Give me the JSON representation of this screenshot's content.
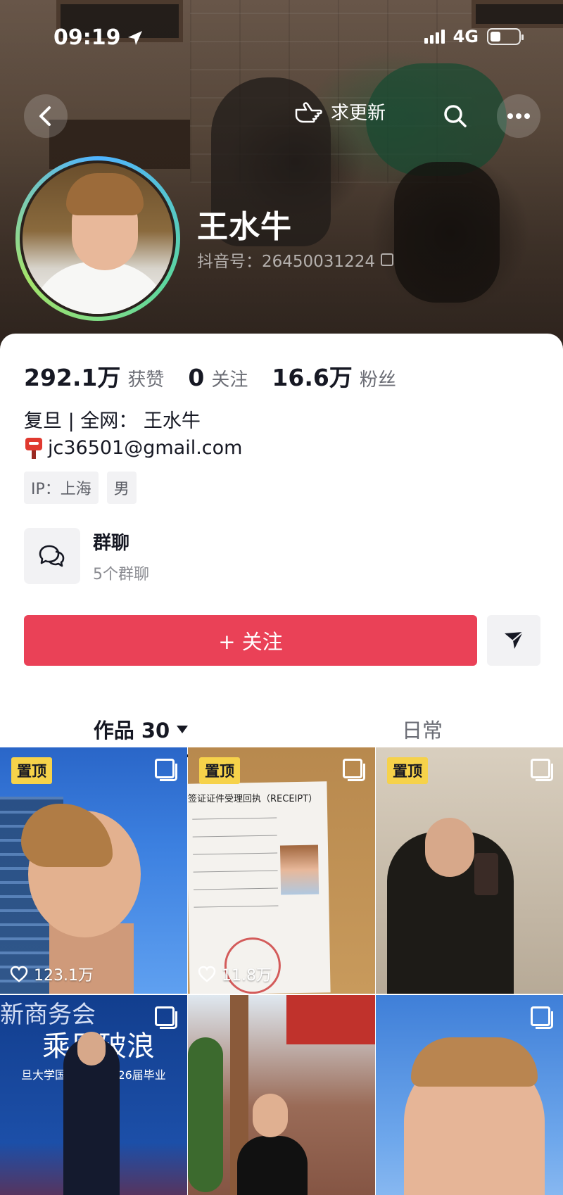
{
  "status_bar": {
    "time": "09:19",
    "network": "4G"
  },
  "header": {
    "update_label": "求更新",
    "name": "王水牛",
    "douyin_id": "抖音号：26450031224"
  },
  "stats": [
    {
      "num": "292.1万",
      "label": "获赞"
    },
    {
      "num": "0",
      "label": "关注"
    },
    {
      "num": "16.6万",
      "label": "粉丝"
    }
  ],
  "bio": {
    "line1": "复旦 |  全网：  王水牛",
    "email": "jc36501@gmail.com"
  },
  "tags": [
    "IP：上海",
    "男"
  ],
  "group": {
    "title": "群聊",
    "sub": "5个群聊"
  },
  "follow_label": "+ 关注",
  "tabs": {
    "works": "作品 30",
    "daily": "日常"
  },
  "grid": {
    "pin_label": "置顶",
    "tiles": [
      {
        "pinned": true,
        "likes": "123.1万"
      },
      {
        "pinned": true,
        "likes": "11.8万",
        "doc_title": "签证证件受理回执（RECEIPT）"
      },
      {
        "pinned": true
      },
      {
        "banner_top": "新商务会",
        "banner_mid": "乘风破浪",
        "banner_sub": "旦大学国际文化 2026届毕业"
      },
      {},
      {}
    ]
  }
}
